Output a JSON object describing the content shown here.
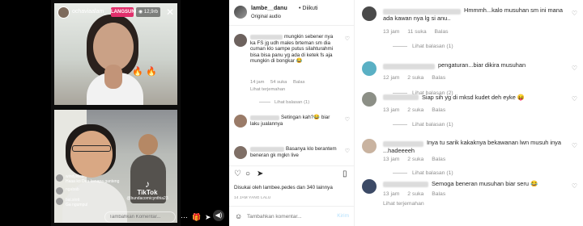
{
  "live": {
    "host_name": "ochaviaalam_",
    "badge": "LANGSUNG",
    "viewers": "◉ 12,9rb",
    "close": "✕",
    "comments": [
      {
        "user": "windyklea",
        "text": "Haaa ko Dea kenapa ganteng"
      },
      {
        "user": "ngabab",
        "text": ""
      },
      {
        "user": "bai.slott",
        "text": "Ga ngumpul"
      }
    ],
    "comment_placeholder": "Tambahkan Komentar...",
    "icons": [
      "more-icon",
      "gift-icon",
      "send-icon",
      "heart-icon"
    ],
    "tiktok_logo": "♪",
    "tiktok_name": "TikTok",
    "tiktok_handle": "@bundacornicynthia23",
    "volume": "◀)"
  },
  "post": {
    "username": "lambe__danu",
    "follow": "• Diikuti",
    "audio": "Original audio",
    "comments": [
      {
        "text": "mungkin sebener nya ka FS jg udh males brteman sm dia cuman klo sampe putus silahturahmi bisa bisa panu yg ada di ketek fs aja mungkin di bongkar 😂",
        "time": "14 jam",
        "likes": "54 suka",
        "reply": "Balas",
        "translate": "Lihat terjemahan",
        "more": "Lihat balasan (1)"
      },
      {
        "text": "Setingan kah?😂 biar laku jualannya",
        "time": "",
        "likes": "",
        "reply": "",
        "translate": "",
        "more": ""
      },
      {
        "text": "Basanya klo berantem beneran gk mgkn live",
        "time": "",
        "likes": "",
        "reply": "",
        "translate": "",
        "more": ""
      }
    ],
    "liked_by": "Disukai oleh lambee.pedes dan 340 lainnya",
    "post_time": "14 JAM YANG LALU",
    "add_comment_placeholder": "Tambahkan komentar...",
    "post_button": "Kirim",
    "emoji": "☺"
  },
  "right": {
    "comments": [
      {
        "text": "Hmmmh...kalo musuhan sm ini mana ada kawan nya lg si anu..",
        "time": "13 jam",
        "likes": "11 suka",
        "reply": "Balas",
        "translate": "",
        "more": "Lihat balasan (1)"
      },
      {
        "text": "pengaturan...biar dikira musuhan",
        "time": "12 jam",
        "likes": "2 suka",
        "reply": "Balas",
        "translate": "",
        "more": "Lihat balasan (2)"
      },
      {
        "text": "Siap sih yg di mksd kudet deh eyke 😝",
        "time": "13 jam",
        "likes": "2 suka",
        "reply": "Balas",
        "translate": "",
        "more": "Lihat balasan (1)"
      },
      {
        "text": "Inya tu sarik kakaknya bekawanan lwn musuh inya ...hadeeeeh",
        "time": "13 jam",
        "likes": "2 suka",
        "reply": "Balas",
        "translate": "",
        "more": "Lihat balasan (1)"
      },
      {
        "text": "Semoga beneran musuhan biar seru 😂",
        "time": "13 jam",
        "likes": "2 suka",
        "reply": "Balas",
        "translate": "Lihat terjemahan",
        "more": ""
      }
    ]
  },
  "colors": {
    "live_badge": "#e1306c",
    "muted": "#8e8e8e",
    "post_btn": "#b2dffc"
  }
}
